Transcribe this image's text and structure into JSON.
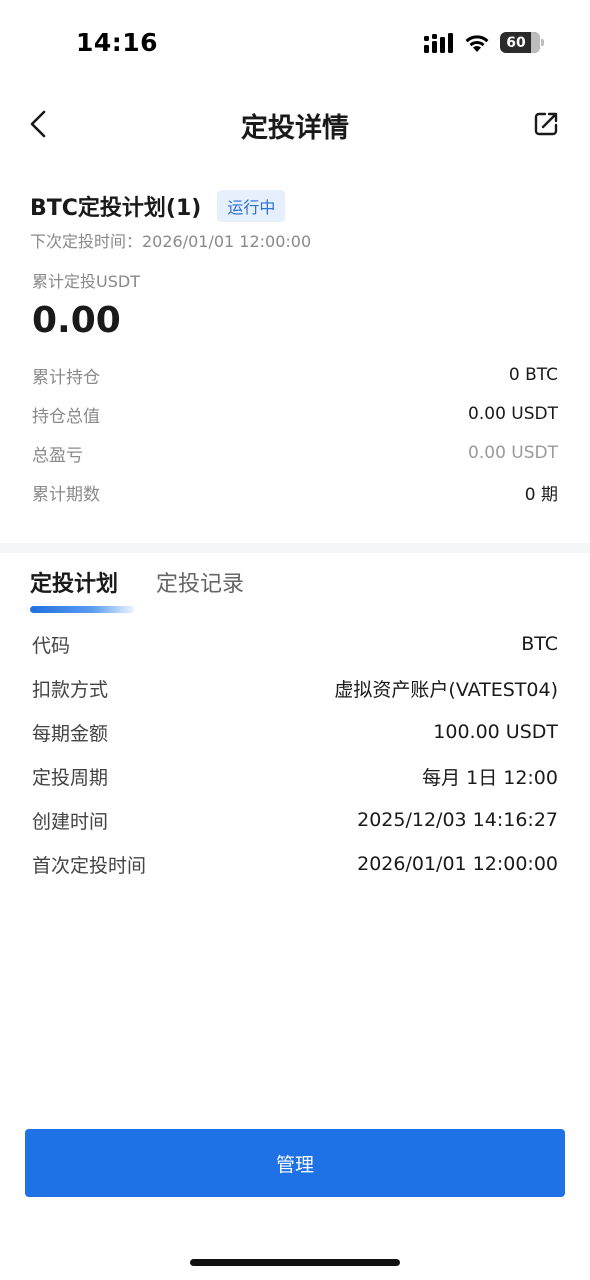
{
  "status_bar": {
    "time": "14:16",
    "battery": "60"
  },
  "nav": {
    "title": "定投详情"
  },
  "summary": {
    "plan_name": "BTC定投计划(1)",
    "status": "运行中",
    "next_time": "下次定投时间：2026/01/01 12:00:00",
    "total_label": "累计定投USDT",
    "total_value": "0.00",
    "rows": [
      {
        "label": "累计持仓",
        "value": "0 BTC"
      },
      {
        "label": "持仓总值",
        "value": "0.00 USDT"
      },
      {
        "label": "总盈亏",
        "value": "0.00 USDT"
      },
      {
        "label": "累计期数",
        "value": "0 期"
      }
    ]
  },
  "tabs": [
    {
      "label": "定投计划"
    },
    {
      "label": "定投记录"
    }
  ],
  "details": [
    {
      "label": "代码",
      "value": "BTC"
    },
    {
      "label": "扣款方式",
      "value": "虚拟资产账户(VATEST04)"
    },
    {
      "label": "每期金额",
      "value": "100.00 USDT"
    },
    {
      "label": "定投周期",
      "value": "每月 1日 12:00"
    },
    {
      "label": "创建时间",
      "value": "2025/12/03 14:16:27"
    },
    {
      "label": "首次定投时间",
      "value": "2026/01/01 12:00:00"
    }
  ],
  "actions": {
    "manage_label": "管理"
  },
  "colors": {
    "accent": "#1e72e6",
    "badge_bg": "#e6f0fc",
    "badge_text": "#2b72d6"
  },
  "icons": {
    "back": "chevron-left-icon",
    "share": "share-icon",
    "signal": "signal-icon",
    "wifi": "wifi-icon",
    "battery": "battery-icon"
  }
}
